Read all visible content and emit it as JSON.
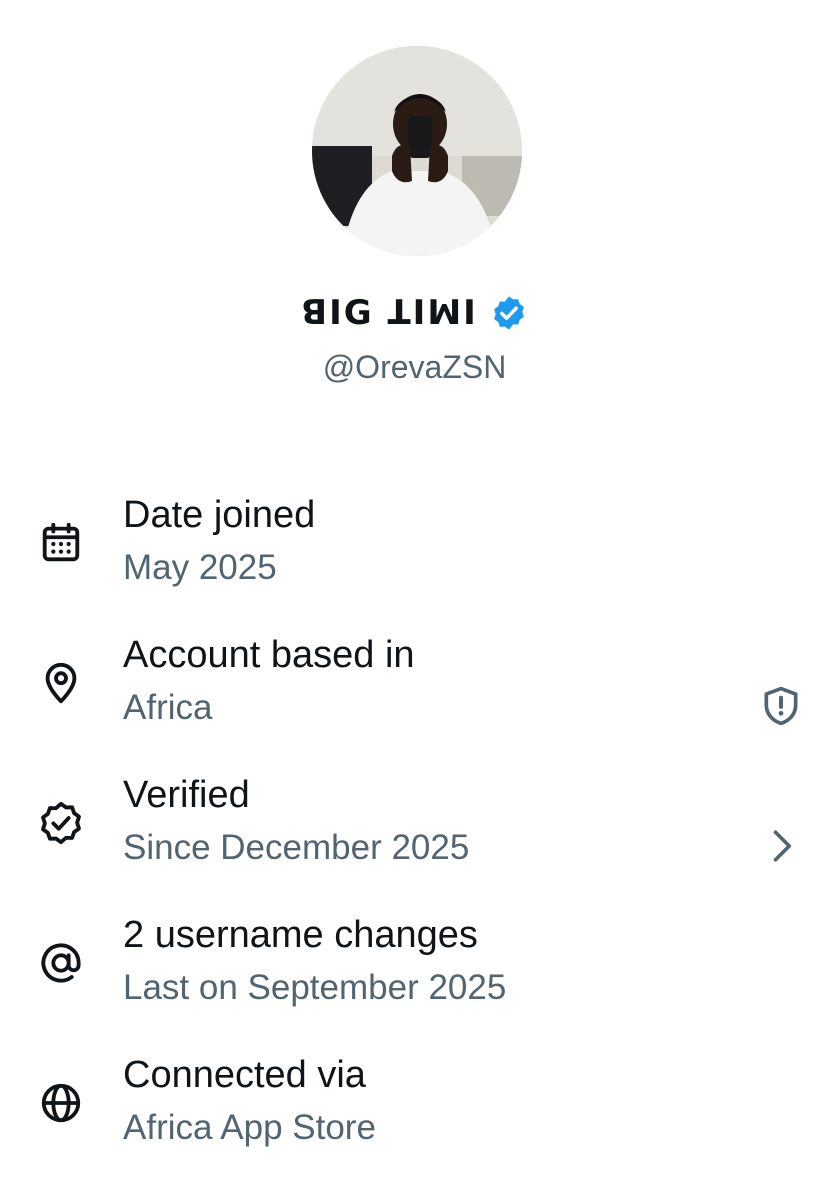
{
  "profile": {
    "display_name": "ꓭIG ꓕIꟽI",
    "handle": "@OrevaZSN",
    "verified": true,
    "avatar_icon": "profile-photo",
    "badge_color": "#1d9bf0"
  },
  "about": {
    "items": [
      {
        "icon": "calendar-icon",
        "title": "Date joined",
        "subtitle": "May 2025"
      },
      {
        "icon": "location-pin-icon",
        "title": "Account based in",
        "subtitle": "Africa",
        "trailing_icon": "shield-alert-icon"
      },
      {
        "icon": "verified-badge-icon",
        "title": "Verified",
        "subtitle": "Since December 2025",
        "trailing_icon": "chevron-right-icon"
      },
      {
        "icon": "at-sign-icon",
        "title": "2 username changes",
        "subtitle": "Last on September 2025"
      },
      {
        "icon": "globe-icon",
        "title": "Connected via",
        "subtitle": "Africa App Store"
      }
    ]
  },
  "colors": {
    "primary_text": "#0f1419",
    "secondary_text": "#536471"
  }
}
